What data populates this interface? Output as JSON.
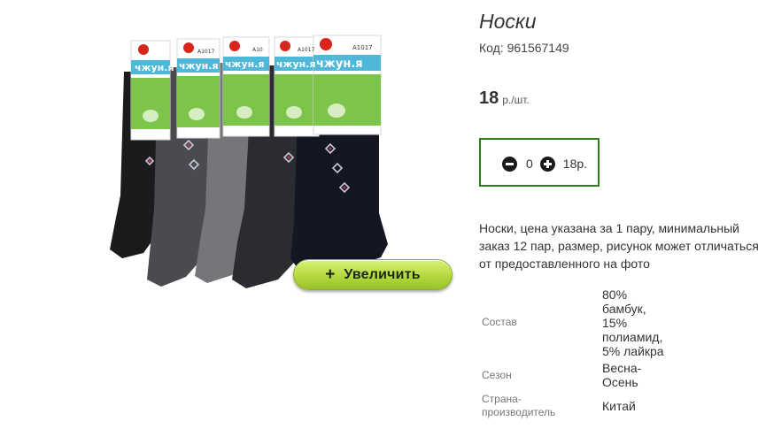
{
  "product": {
    "title": "Носки",
    "sku": "Код: 961567149",
    "price_amount": "18",
    "price_unit": "р./шт.",
    "zoom_plus": "+",
    "zoom_label": "Увеличить",
    "description": "Носки, цена указана за 1 пару, минимальный\nзаказ 12 пар, размер, рисунок может отличаться\nот предоставленного на фото"
  },
  "image": {
    "brand_text": "чжун.я",
    "article_texts": [
      "A1017",
      "A1017",
      "A10",
      "A1017"
    ],
    "tag_color": "#ffffff",
    "band_color": "#4fb8d8",
    "leaf_color": "#7cc44a",
    "sock_colors": [
      "#1b1b1d",
      "#4a4b50",
      "#75767a",
      "#2b2c31",
      "#141722"
    ]
  },
  "quantity": {
    "minus_icon": "minus-circle-icon",
    "plus_icon": "plus-circle-icon",
    "value": "0",
    "total": "18р."
  },
  "specs": {
    "composition_label": "Состав",
    "composition_value": "80%\nбамбук,\n15%\nполиамид,\n5% лайкра",
    "season_label": "Сезон",
    "season_value": "Весна-\nОсень",
    "country_label": "Страна-\nпроизводитель",
    "country_value": "Китай"
  },
  "colors": {
    "accent_border": "#2e7d1e",
    "zoom_button": "#b4d83c"
  }
}
